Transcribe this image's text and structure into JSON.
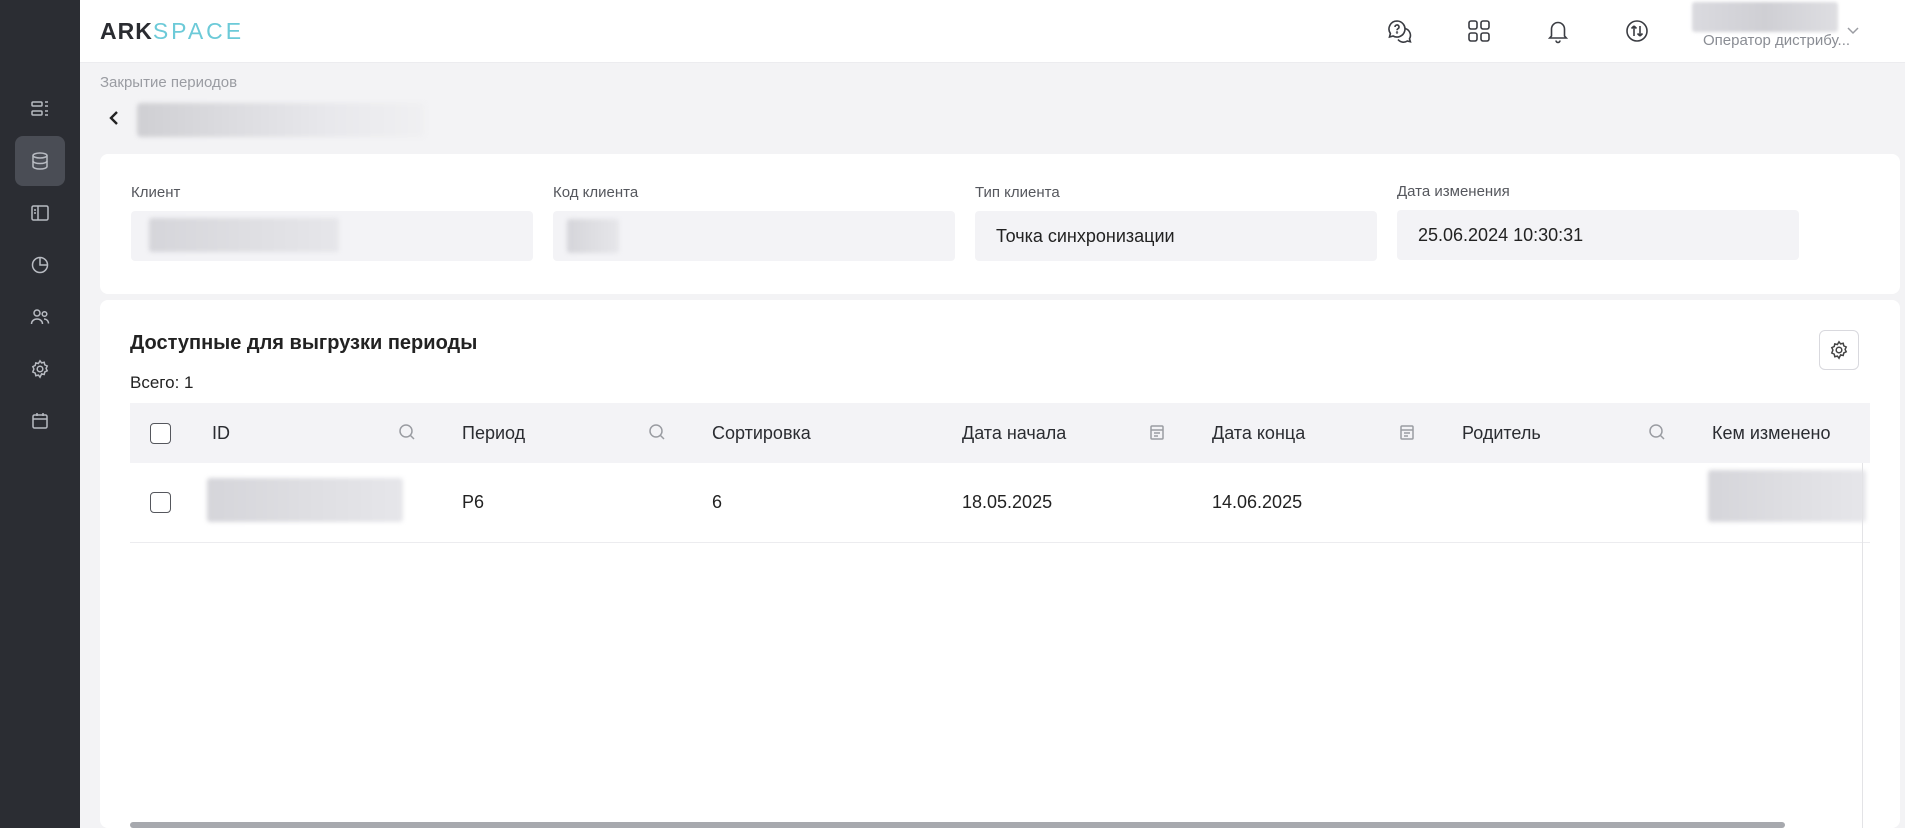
{
  "app": {
    "logo_ark": "ARK",
    "logo_space": "SPACE"
  },
  "header": {
    "user_role": "Оператор дистрибу..."
  },
  "sidebar": {
    "items": [
      {
        "icon": "list-icon"
      },
      {
        "icon": "database-icon",
        "active": true
      },
      {
        "icon": "layout-icon"
      },
      {
        "icon": "pie-chart-icon"
      },
      {
        "icon": "users-icon"
      },
      {
        "icon": "gear-icon"
      },
      {
        "icon": "calendar-icon"
      }
    ]
  },
  "breadcrumb": "Закрытие периодов",
  "info": {
    "client_label": "Клиент",
    "client_code_label": "Код клиента",
    "client_type_label": "Тип клиента",
    "client_type_value": "Точка синхронизации",
    "changed_date_label": "Дата изменения",
    "changed_date_value": "25.06.2024 10:30:31"
  },
  "table": {
    "title": "Доступные для выгрузки периоды",
    "total": "Всего: 1",
    "columns": [
      "ID",
      "Период",
      "Сортировка",
      "Дата начала",
      "Дата конца",
      "Родитель",
      "Кем изменено"
    ],
    "rows": [
      {
        "id": "",
        "period": "P6",
        "sort": "6",
        "start": "18.05.2025",
        "end": "14.06.2025",
        "parent": "",
        "changed_by": ""
      }
    ]
  }
}
